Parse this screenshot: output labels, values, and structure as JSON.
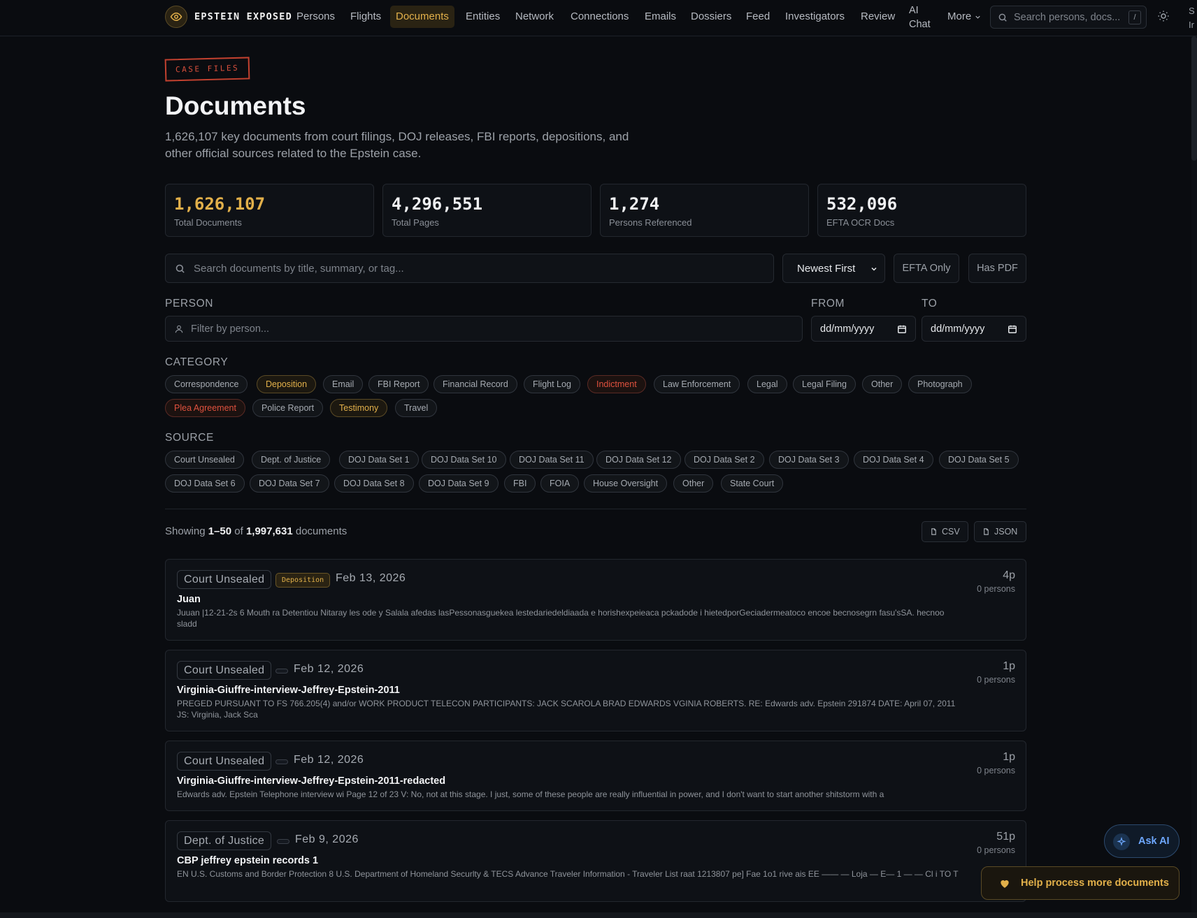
{
  "nav": {
    "brand": "EPSTEIN EXPOSED",
    "items": [
      "Persons",
      "Flights",
      "Documents",
      "Entities",
      "Network",
      "Connections",
      "Emails",
      "Dossiers",
      "Feed",
      "Investigators",
      "Review"
    ],
    "active": "Documents",
    "ai_chat_line1": "AI",
    "ai_chat_line2": "Chat",
    "more": "More",
    "search_placeholder": "Search persons, docs...",
    "search_shortcut": "/",
    "cut_text_line1": "S",
    "cut_text_line2": "Ir"
  },
  "header": {
    "badge": "CASE FILES",
    "title": "Documents",
    "description": "1,626,107 key documents from court filings, DOJ releases, FBI reports, depositions, and other official sources related to the Epstein case."
  },
  "stats": [
    {
      "value": "1,626,107",
      "label": "Total Documents"
    },
    {
      "value": "4,296,551",
      "label": "Total Pages"
    },
    {
      "value": "1,274",
      "label": "Persons Referenced"
    },
    {
      "value": "532,096",
      "label": "EFTA OCR Docs"
    }
  ],
  "search": {
    "placeholder": "Search documents by title, summary, or tag...",
    "sort_value": "Newest First",
    "efta_only": "EFTA Only",
    "has_pdf": "Has PDF"
  },
  "filters": {
    "person_label": "PERSON",
    "person_placeholder": "Filter by person...",
    "from_label": "FROM",
    "to_label": "TO",
    "from_value": "dd/mm/yyyy",
    "to_value": "dd/mm/yyyy",
    "category_label": "CATEGORY",
    "categories": [
      "Correspondence",
      "Deposition",
      "Email",
      "FBI Report",
      "Financial Record",
      "Flight Log",
      "Indictment",
      "Law Enforcement",
      "Legal",
      "Legal Filing",
      "Other",
      "Photograph",
      "Plea Agreement",
      "Police Report",
      "Testimony",
      "Travel"
    ],
    "source_label": "SOURCE",
    "sources": [
      "Court Unsealed",
      "Dept. of Justice",
      "DOJ Data Set 1",
      "DOJ Data Set 10",
      "DOJ Data Set 11",
      "DOJ Data Set 12",
      "DOJ Data Set 2",
      "DOJ Data Set 3",
      "DOJ Data Set 4",
      "DOJ Data Set 5",
      "DOJ Data Set 6",
      "DOJ Data Set 7",
      "DOJ Data Set 8",
      "DOJ Data Set 9",
      "FBI",
      "FOIA",
      "House Oversight",
      "Other",
      "State Court"
    ]
  },
  "results": {
    "showing_prefix": "Showing",
    "range": "1–50",
    "of": "of",
    "total": "1,997,631",
    "suffix": "documents",
    "csv": "CSV",
    "json": "JSON"
  },
  "documents": [
    {
      "source": "Court Unsealed",
      "category": "Deposition",
      "date": "Feb 13, 2026",
      "title": "Juan",
      "summary": "Juuan |12-21-2s 6 Mouth ra Detentiou Nitaray les ode y Salala afedas lasPessonasguekea lestedariedeldiaada e horishexpeieaca pckadode i hietedporGeciadermeatoco encoe becnosegrn fasu'sSA. hecnoo sladd",
      "pages": "4p",
      "persons": "0 persons"
    },
    {
      "source": "Court Unsealed",
      "category": "",
      "date": "Feb 12, 2026",
      "title": "Virginia-Giuffre-interview-Jeffrey-Epstein-2011",
      "summary": "PREGED PURSUANT TO FS 766.205(4) and/or WORK PRODUCT TELECON PARTICIPANTS: JACK SCAROLA BRAD EDWARDS VGINIA ROBERTS. RE: Edwards adv. Epstein 291874 DATE: April 07, 2011 JS: Virginia, Jack Sca",
      "pages": "1p",
      "persons": "0 persons"
    },
    {
      "source": "Court Unsealed",
      "category": "",
      "date": "Feb 12, 2026",
      "title": "Virginia-Giuffre-interview-Jeffrey-Epstein-2011-redacted",
      "summary": "Edwards adv. Epstein Telephone interview wi Page 12 of 23 V: No, not at this stage. I just, some of these people are really influential in power, and I don't want to start another shitstorm with a",
      "pages": "1p",
      "persons": "0 persons"
    },
    {
      "source": "Dept. of Justice",
      "category": "",
      "date": "Feb 9, 2026",
      "title": "CBP jeffrey epstein records 1",
      "summary": "EN U.S. Customs and Border Protection 8 U.S. Department of Homeland Securlty & TECS Advance Traveler Information - Traveler List raat 1213807 pe] Fae 1o1 rive ais EE —— — Loja — E— 1 — — Cl i TO T",
      "pages": "51p",
      "persons": "0 persons"
    }
  ],
  "floating": {
    "ask_ai": "Ask AI",
    "help": "Help process more documents"
  },
  "colors": {
    "background": "#0a0c10",
    "gold_accent": "#e2b04a",
    "red_accent": "#e0513e",
    "blue_accent": "#6ea8ff"
  },
  "icons": [
    "eye-icon",
    "search-icon",
    "chevron-down-icon",
    "sun-icon",
    "user-icon",
    "calendar-icon",
    "file-icon",
    "sparkle-icon",
    "heart-icon"
  ]
}
